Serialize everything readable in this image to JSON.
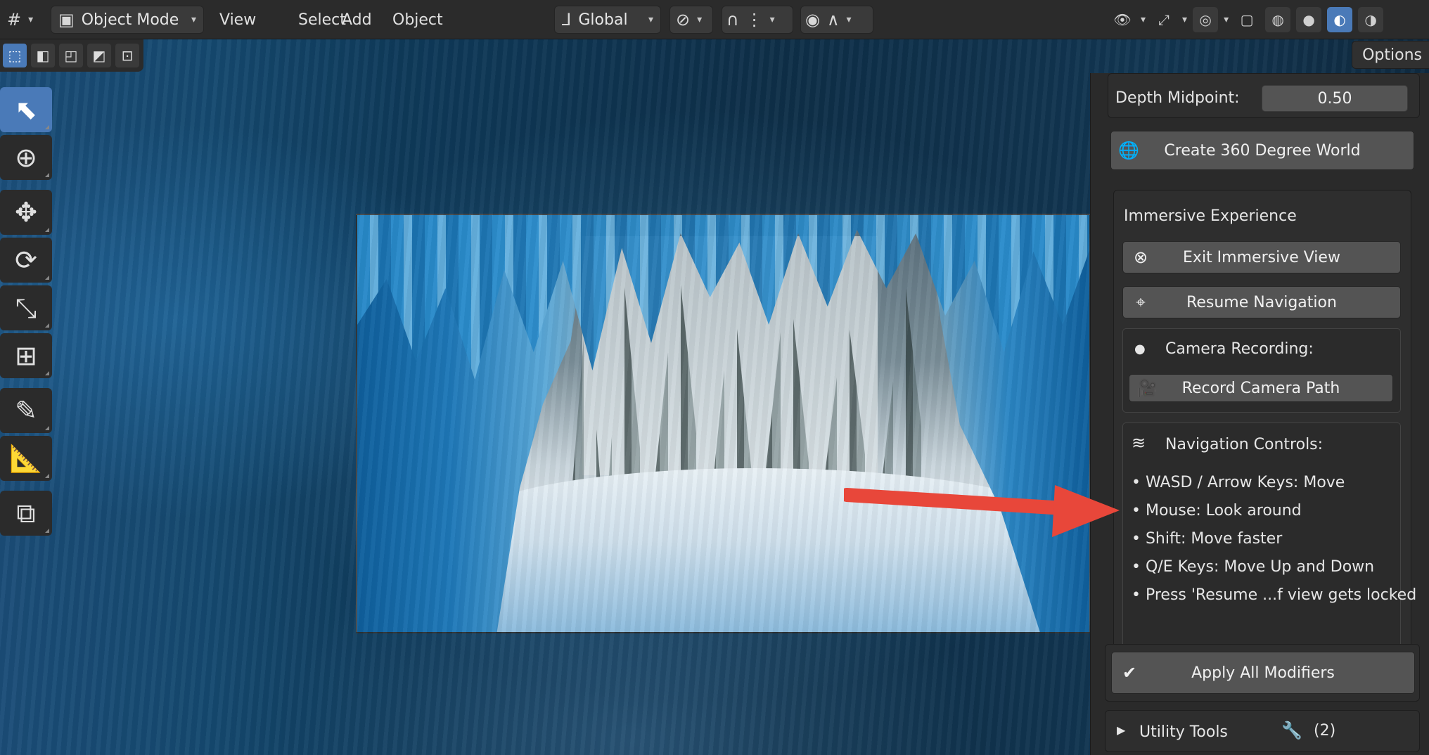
{
  "header": {
    "mode_label": "Object Mode",
    "menus": [
      "View",
      "Select",
      "Add",
      "Object"
    ],
    "transform_orientation": "Global"
  },
  "options_tab": "Options",
  "panel": {
    "depth_midpoint": {
      "label": "Depth Midpoint:",
      "value": "0.50"
    },
    "create_world_button": "Create 360 Degree World",
    "immersive": {
      "title": "Immersive Experience",
      "exit_button": "Exit Immersive View",
      "resume_button": "Resume Navigation",
      "camera_recording_label": "Camera Recording:",
      "record_button": "Record Camera Path",
      "nav_controls_title": "Navigation Controls:",
      "nav_lines": [
        "• WASD / Arrow Keys: Move",
        "• Mouse: Look around",
        "• Shift: Move faster",
        "• Q/E Keys: Move Up and Down",
        "• Press 'Resume ...f view gets locked"
      ]
    },
    "apply_modifiers_button": "Apply All Modifiers",
    "utility_tools": {
      "label": "Utility Tools",
      "count": "(2)"
    }
  },
  "colors": {
    "accent": "#4a7ab8",
    "annotation_arrow": "#e8473a",
    "panel_bg": "#2a2a2a",
    "button_bg": "#545454"
  },
  "icons": {
    "editor_type": "grid-icon",
    "object_mode": "cube-square-icon",
    "orientation": "axes-icon",
    "pivot": "link-icon",
    "snap": "magnet-icon",
    "proportional": "circle-dot-icon",
    "visibility": "eye-icon",
    "gizmo": "gizmo-icon",
    "overlay": "overlay-icon",
    "xray": "xray-icon",
    "shading_wire": "wireframe-sphere-icon",
    "shading_solid": "solid-sphere-icon",
    "shading_material": "material-sphere-icon",
    "shading_rendered": "rendered-sphere-icon"
  }
}
